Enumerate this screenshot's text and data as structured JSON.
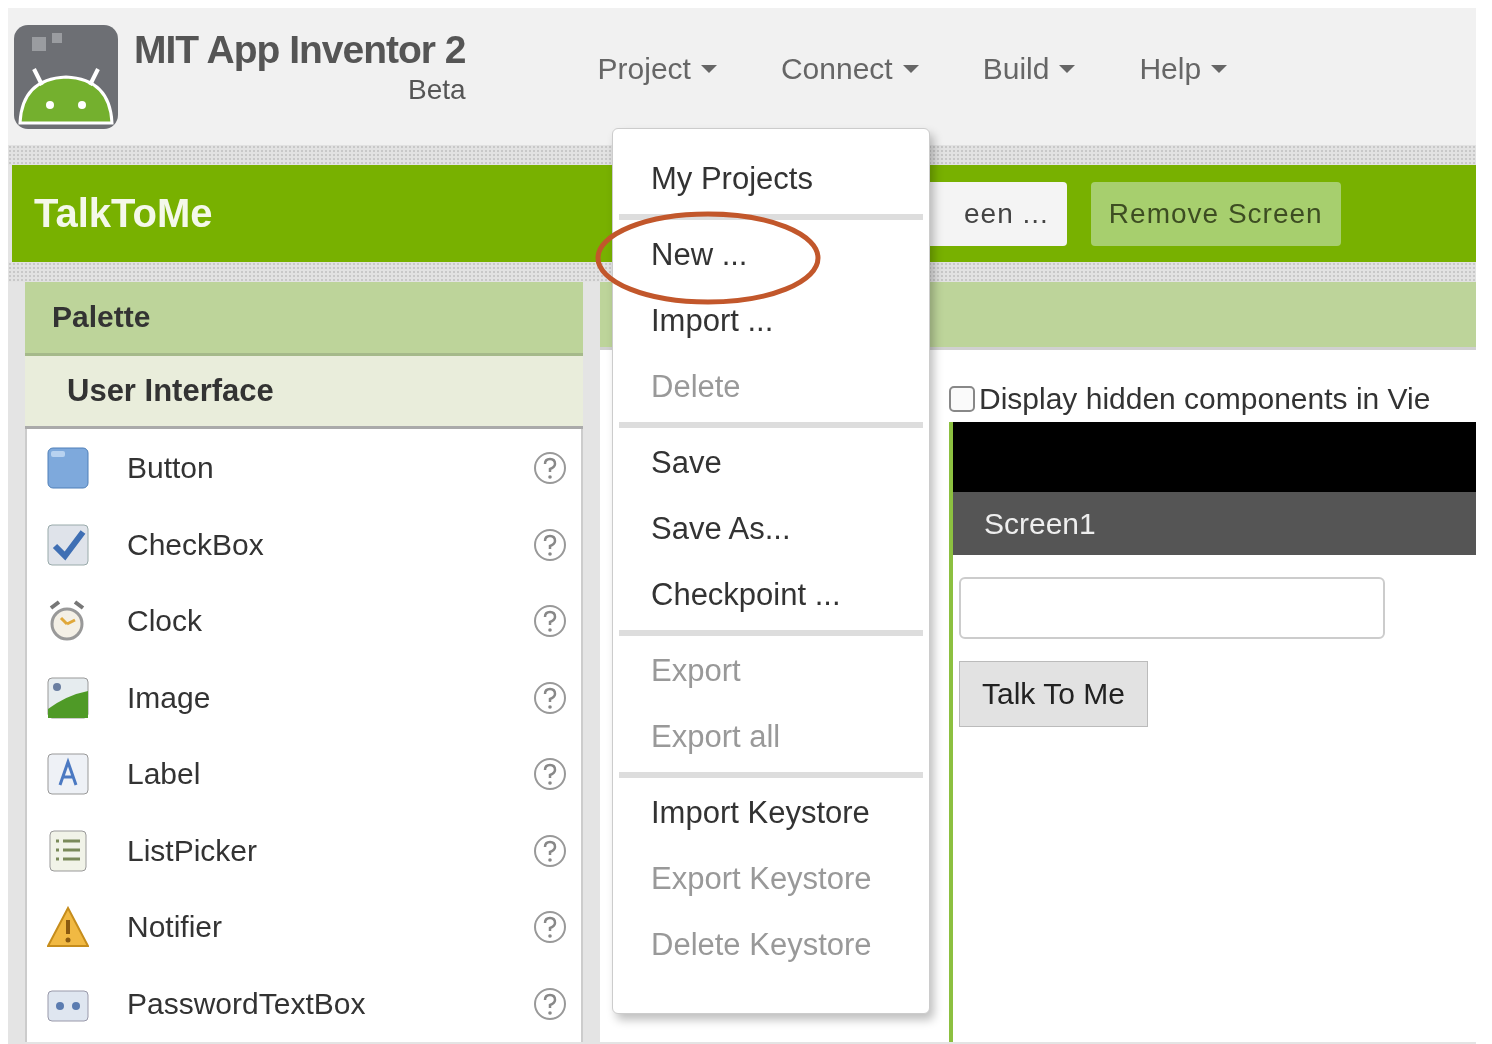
{
  "header": {
    "title": "MIT App Inventor 2",
    "subtitle": "Beta",
    "nav": [
      {
        "label": "Project"
      },
      {
        "label": "Connect"
      },
      {
        "label": "Build"
      },
      {
        "label": "Help"
      }
    ]
  },
  "project_bar": {
    "title": "TalkToMe",
    "buttons": [
      {
        "label": "een ...",
        "kind": "light"
      },
      {
        "label": "Remove Screen",
        "kind": "muted"
      }
    ]
  },
  "palette": {
    "title": "Palette",
    "category": "User Interface",
    "items": [
      {
        "label": "Button",
        "kind": "button"
      },
      {
        "label": "CheckBox",
        "kind": "checkbox"
      },
      {
        "label": "Clock",
        "kind": "clock"
      },
      {
        "label": "Image",
        "kind": "image"
      },
      {
        "label": "Label",
        "kind": "label"
      },
      {
        "label": "ListPicker",
        "kind": "listpicker"
      },
      {
        "label": "Notifier",
        "kind": "notifier"
      },
      {
        "label": "PasswordTextBox",
        "kind": "password"
      }
    ]
  },
  "viewer": {
    "hidden_checkbox": {
      "label": "Display hidden components in Vie",
      "checked": false
    },
    "screen_title": "Screen1",
    "button_label": "Talk To Me"
  },
  "menu": {
    "items": [
      {
        "kind": "item",
        "label": "My Projects",
        "disabled": false
      },
      {
        "kind": "separator"
      },
      {
        "kind": "item",
        "label": "New ...",
        "disabled": false
      },
      {
        "kind": "item",
        "label": "Import ...",
        "disabled": false
      },
      {
        "kind": "item",
        "label": "Delete",
        "disabled": true
      },
      {
        "kind": "separator"
      },
      {
        "kind": "item",
        "label": "Save",
        "disabled": false
      },
      {
        "kind": "item",
        "label": "Save As...",
        "disabled": false
      },
      {
        "kind": "item",
        "label": "Checkpoint ...",
        "disabled": false
      },
      {
        "kind": "separator"
      },
      {
        "kind": "item",
        "label": "Export",
        "disabled": true
      },
      {
        "kind": "item",
        "label": "Export all",
        "disabled": true
      },
      {
        "kind": "separator"
      },
      {
        "kind": "item",
        "label": "Import Keystore",
        "disabled": false
      },
      {
        "kind": "item",
        "label": "Export Keystore",
        "disabled": true
      },
      {
        "kind": "item",
        "label": "Delete Keystore",
        "disabled": true
      }
    ]
  }
}
